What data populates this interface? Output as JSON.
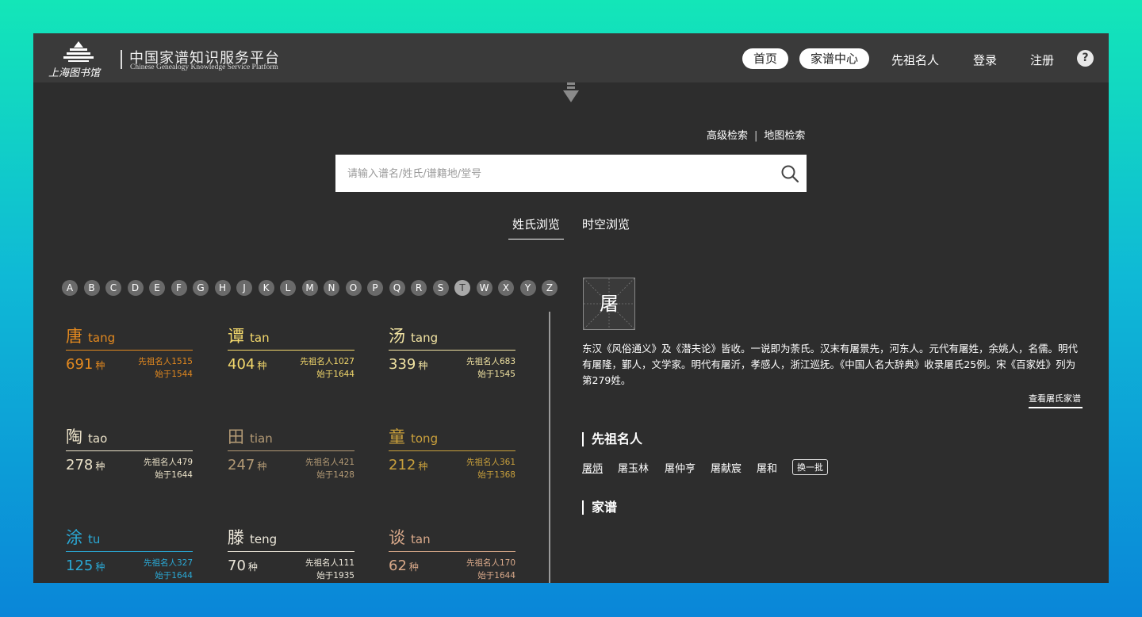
{
  "header": {
    "logo_script": "上海图书馆",
    "title": "中国家谱知识服务平台",
    "subtitle": "Chinese Genealogy Knowledge Service Platform",
    "nav": [
      {
        "label": "首页",
        "style": "pill"
      },
      {
        "label": "家谱中心",
        "style": "pill"
      },
      {
        "label": "先祖名人",
        "style": "link"
      },
      {
        "label": "登录",
        "style": "link"
      },
      {
        "label": "注册",
        "style": "link"
      }
    ],
    "help_label": "?"
  },
  "search": {
    "advanced_label": "高级检索",
    "separator": "|",
    "map_label": "地图检索",
    "placeholder": "请输入谱名/姓氏/谱籍地/堂号",
    "value": ""
  },
  "tabs": [
    {
      "label": "姓氏浏览",
      "active": true
    },
    {
      "label": "时空浏览",
      "active": false
    }
  ],
  "alphabet": {
    "letters": [
      "A",
      "B",
      "C",
      "D",
      "E",
      "F",
      "G",
      "H",
      "J",
      "K",
      "L",
      "M",
      "N",
      "O",
      "P",
      "Q",
      "R",
      "S",
      "T",
      "W",
      "X",
      "Y",
      "Z"
    ],
    "active": "T"
  },
  "surnames": [
    {
      "name": "唐",
      "pinyin": "tang",
      "count": "691",
      "unit": "种",
      "famous": "先祖名人1515",
      "since": "始于1544",
      "color": "#e3891f"
    },
    {
      "name": "谭",
      "pinyin": "tan",
      "count": "404",
      "unit": "种",
      "famous": "先祖名人1027",
      "since": "始于1644",
      "color": "#f4d96c"
    },
    {
      "name": "汤",
      "pinyin": "tang",
      "count": "339",
      "unit": "种",
      "famous": "先祖名人683",
      "since": "始于1545",
      "color": "#f1e3a2"
    },
    {
      "name": "陶",
      "pinyin": "tao",
      "count": "278",
      "unit": "种",
      "famous": "先祖名人479",
      "since": "始于1644",
      "color": "#ebe2c9"
    },
    {
      "name": "田",
      "pinyin": "tian",
      "count": "247",
      "unit": "种",
      "famous": "先祖名人421",
      "since": "始于1428",
      "color": "#b39a75"
    },
    {
      "name": "童",
      "pinyin": "tong",
      "count": "212",
      "unit": "种",
      "famous": "先祖名人361",
      "since": "始于1368",
      "color": "#c9a03c"
    },
    {
      "name": "涂",
      "pinyin": "tu",
      "count": "125",
      "unit": "种",
      "famous": "先祖名人327",
      "since": "始于1644",
      "color": "#2aa9d6"
    },
    {
      "name": "滕",
      "pinyin": "teng",
      "count": "70",
      "unit": "种",
      "famous": "先祖名人111",
      "since": "始于1935",
      "color": "#ece7da"
    },
    {
      "name": "谈",
      "pinyin": "tan",
      "count": "62",
      "unit": "种",
      "famous": "先祖名人170",
      "since": "始于1644",
      "color": "#d9a98a"
    }
  ],
  "detail": {
    "character": "屠",
    "description": "东汉《风俗通义》及《潜夫论》皆收。一说即为荼氏。汉末有屠景先，河东人。元代有屠姓，余姚人，名儒。明代有屠隆，鄞人，文学家。明代有屠沂，孝感人，浙江巡抚。《中国人名大辞典》收录屠氏25例。宋《百家姓》列为第279姓。",
    "view_link": "查看屠氏家谱",
    "ancestors_title": "先祖名人",
    "ancestors": [
      "屠炳",
      "屠玉林",
      "屠仲亨",
      "屠献宸",
      "屠和"
    ],
    "refresh_label": "换一批",
    "genealogy_title": "家谱"
  }
}
